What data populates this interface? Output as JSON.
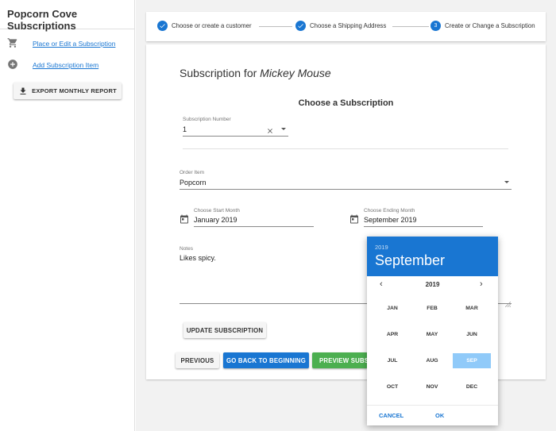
{
  "sidebar": {
    "app_title": "Popcorn Cove Subscriptions",
    "items": [
      {
        "label": "Place or Edit a Subscription",
        "icon": "cart-icon"
      },
      {
        "label": "Add Subscription Item",
        "icon": "add-circle-icon"
      }
    ],
    "export_label": "EXPORT MONTHLY REPORT"
  },
  "stepper": {
    "steps": [
      {
        "label": "Choose or create a customer",
        "state": "done"
      },
      {
        "label": "Choose a Shipping Address",
        "state": "done"
      },
      {
        "label": "Create or Change a Subscription",
        "state": "active",
        "number": "3"
      }
    ]
  },
  "form": {
    "heading_prefix": "Subscription for ",
    "customer_name": "Mickey Mouse",
    "section_title": "Choose a Subscription",
    "subscription_number_label": "Subscription Number",
    "subscription_number_value": "1",
    "order_item_label": "Order Item",
    "order_item_value": "Popcorn",
    "start_month_label": "Choose Start Month",
    "start_month_value": "January 2019",
    "end_month_label": "Choose Ending Month",
    "end_month_value": "September 2019",
    "notes_label": "Notes",
    "notes_value": "Likes spicy.",
    "update_label": "UPDATE SUBSCRIPTION",
    "previous_label": "PREVIOUS",
    "go_back_label": "GO BACK TO BEGINNING",
    "preview_label": "PREVIEW SUBSC"
  },
  "picker": {
    "year_small": "2019",
    "selected_month": "September",
    "nav_year": "2019",
    "months": [
      "JAN",
      "FEB",
      "MAR",
      "APR",
      "MAY",
      "JUN",
      "JUL",
      "AUG",
      "SEP",
      "OCT",
      "NOV",
      "DEC"
    ],
    "selected_index": 8,
    "cancel_label": "CANCEL",
    "ok_label": "OK"
  },
  "colors": {
    "primary": "#1976d2",
    "success": "#4caf50",
    "selected_month_bg": "#90caf9"
  }
}
